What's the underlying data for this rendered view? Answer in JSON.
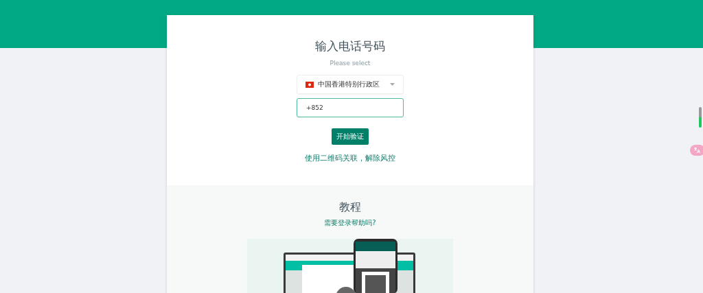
{
  "login": {
    "title": "输入电话号码",
    "subtitle": "Please select",
    "country": {
      "name": "中国香港特别行政区"
    },
    "phone": {
      "value": "+852"
    },
    "submit": "开始验证",
    "qr_link": "使用二维码关联，解除风控"
  },
  "tutorial": {
    "title": "教程",
    "help_link": "需要登录帮助吗?"
  }
}
